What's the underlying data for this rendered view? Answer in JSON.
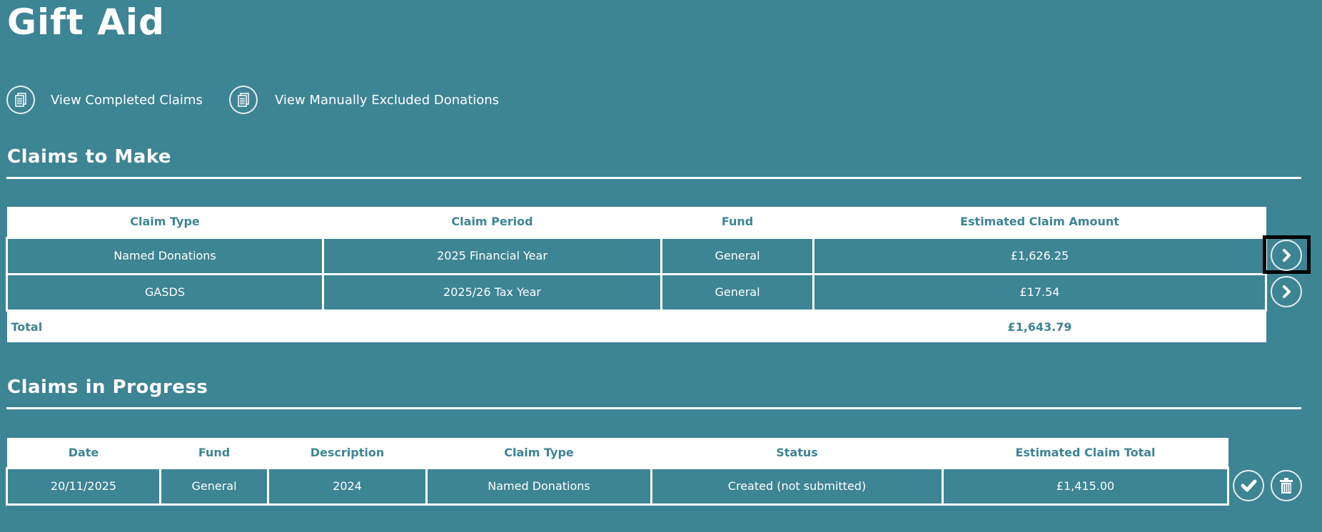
{
  "page_title": "Gift Aid",
  "links": [
    {
      "label": "View Completed Claims",
      "icon": "documents-icon"
    },
    {
      "label": "View Manually Excluded Donations",
      "icon": "documents-icon"
    }
  ],
  "claims_to_make": {
    "title": "Claims to Make",
    "columns": [
      "Claim Type",
      "Claim Period",
      "Fund",
      "Estimated Claim Amount"
    ],
    "rows": [
      {
        "claim_type": "Named Donations",
        "claim_period": "2025 Financial Year",
        "fund": "General",
        "amount": "£1,626.25"
      },
      {
        "claim_type": "GASDS",
        "claim_period": "2025/26 Tax Year",
        "fund": "General",
        "amount": "£17.54"
      }
    ],
    "total_label": "Total",
    "total_amount": "£1,643.79"
  },
  "claims_in_progress": {
    "title": "Claims in Progress",
    "columns": [
      "Date",
      "Fund",
      "Description",
      "Claim Type",
      "Status",
      "Estimated Claim Total"
    ],
    "rows": [
      {
        "date": "20/11/2025",
        "fund": "General",
        "description": "2024",
        "claim_type": "Named Donations",
        "status": "Created (not submitted)",
        "total": "£1,415.00"
      }
    ]
  }
}
